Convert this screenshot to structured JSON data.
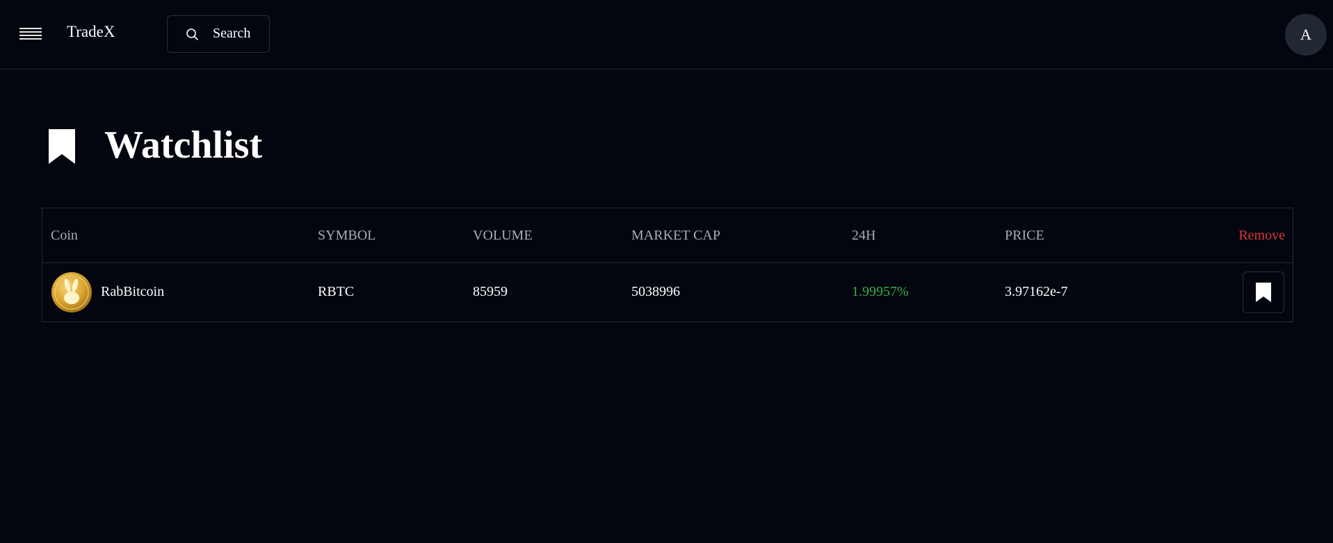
{
  "header": {
    "brand": "TradeX",
    "search_label": "Search",
    "avatar_initial": "A"
  },
  "page": {
    "title": "Watchlist"
  },
  "table": {
    "columns": [
      "Coin",
      "SYMBOL",
      "VOLUME",
      "MARKET CAP",
      "24H",
      "PRICE",
      "Remove"
    ],
    "rows": [
      {
        "coin": "RabBitcoin",
        "symbol": "RBTC",
        "volume": "85959",
        "market_cap": "5038996",
        "change_24h": "1.99957%",
        "price": "3.97162e-7"
      }
    ]
  },
  "colors": {
    "background": "#03060f",
    "positive": "#3fad46",
    "remove": "#d9393a"
  }
}
